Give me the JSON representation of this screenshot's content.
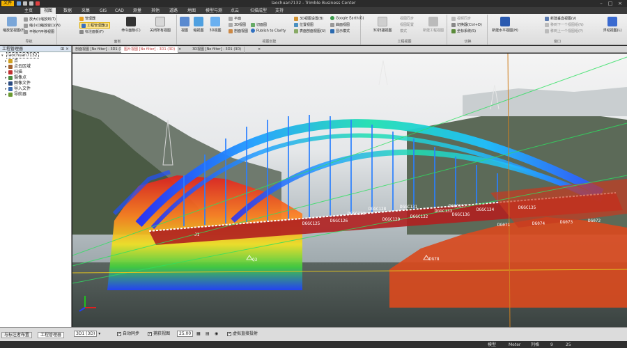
{
  "window": {
    "app_button": "文件",
    "title": "laochuan7132 - Trimble Business Center"
  },
  "ribbon_tabs": [
    {
      "label": "主页"
    },
    {
      "label": "视图"
    },
    {
      "label": "数据"
    },
    {
      "label": "采集"
    },
    {
      "label": "GIS"
    },
    {
      "label": "CAD"
    },
    {
      "label": "测量"
    },
    {
      "label": "其他"
    },
    {
      "label": "道路"
    },
    {
      "label": "地图"
    },
    {
      "label": "模型与测"
    },
    {
      "label": "点云"
    },
    {
      "label": "扫描成型"
    },
    {
      "label": "支持"
    }
  ],
  "ribbon": {
    "g1": {
      "big": "缩放至视图(E)",
      "items": [
        "放大(I)",
        "缩小(O)",
        "平移(P)",
        "缩放到(T)",
        "缩放窗口(W)",
        "平移视图"
      ],
      "label": "导航"
    },
    "g2": {
      "items": [
        "管理器",
        "工程管理器(J)",
        "标注面板(F)"
      ],
      "big": "命令面板(C)",
      "big2": "关闭所有视图",
      "label": "面板"
    },
    "g3": {
      "big1": "视图",
      "big2": "缩视图",
      "big3": "3D视图",
      "items": [
        "平面",
        "3D视图",
        "剖面视图",
        "切面图",
        "Publish to Clarity"
      ],
      "items2": [
        "3D视图设置(B)",
        "位置视图",
        "表面剖面视图(U)"
      ],
      "items3": [
        "Google Earth(G)",
        "曲面视图",
        "显示模式"
      ],
      "label": "视图创建"
    },
    "g4": {
      "big": "3D扫描视图",
      "items": [
        "视图同步",
        "视图配置",
        "模式"
      ],
      "big2": "新建工程视图",
      "label": "工程视图"
    },
    "g5": {
      "items": [
        "视频同步",
        "切换器(Ctrl+D)",
        "坐标系统(S)"
      ],
      "label": "切换"
    },
    "g6": {
      "big": "新建水平视图(H)",
      "items": [
        "新建垂直视图(V)",
        "移到下一个视图组(N)",
        "移到上一个视图组(P)"
      ],
      "big2": "浮动视图(L)",
      "label": "窗口"
    }
  },
  "left_panel": {
    "title": "工程管理器",
    "root": "laochuan7132",
    "nodes": [
      {
        "label": "点"
      },
      {
        "label": "点云区域"
      },
      {
        "label": "扫描"
      },
      {
        "label": "摄像点"
      },
      {
        "label": "图像文件"
      },
      {
        "label": "导入文件"
      },
      {
        "label": "导航器"
      }
    ]
  },
  "doc_tabs": [
    {
      "label": "剖面视图 [No filter] - 3D1 (3D)"
    },
    {
      "label": "图片视图 [No filter] - 3D1 (3D)",
      "active": true
    },
    {
      "label": "3D视图 [No filter] - 3D1 (3D)"
    }
  ],
  "viewport": {
    "point_labels": [
      {
        "text": "DGGC128"
      },
      {
        "text": "DGGC131"
      },
      {
        "text": "DGGC130"
      },
      {
        "text": "DGGC137"
      },
      {
        "text": "DGGC133"
      },
      {
        "text": "DGGC134"
      },
      {
        "text": "DGGC135"
      },
      {
        "text": "DGGC129"
      },
      {
        "text": "DGGC132"
      },
      {
        "text": "DGGC136"
      },
      {
        "text": "DGGC125"
      },
      {
        "text": "DGGC126"
      },
      {
        "text": "DG071"
      },
      {
        "text": "DG074"
      },
      {
        "text": "DG072"
      },
      {
        "text": "DG073"
      },
      {
        "text": "DG78"
      },
      {
        "text": "Q3"
      },
      {
        "text": "J1"
      }
    ]
  },
  "statusbar": {
    "view_select": "3D1 (3D)",
    "cb1": "自动同步",
    "cb2": "捕获视图",
    "zoom_value": "25.00",
    "cb3": "虚拟直接投射",
    "left_tabs": [
      "与标注者布置",
      "工程管理器"
    ],
    "bottom": [
      "模型",
      "Meter",
      "列格",
      "9",
      "25"
    ]
  },
  "colors": {
    "accent": "#f4b400",
    "active_tab": "#e9e9e9",
    "doc_active_text": "#c04040",
    "point_cloud_blue": "#2050ff",
    "point_cloud_red": "#e23020"
  }
}
